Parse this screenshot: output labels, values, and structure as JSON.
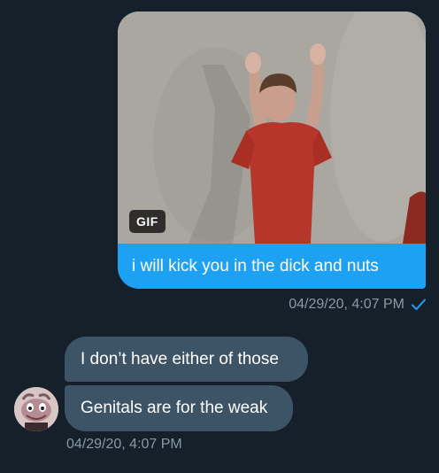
{
  "sent_message": {
    "media_badge": "GIF",
    "text": "i will kick you in the dick and nuts",
    "timestamp": "04/29/20, 4:07 PM",
    "status_icon": "check-icon"
  },
  "received_messages": [
    {
      "text": "I don’t have either of those"
    },
    {
      "text": "Genitals are for the weak"
    }
  ],
  "received_timestamp": "04/29/20, 4:07 PM",
  "colors": {
    "background": "#15202b",
    "sent_bubble": "#1da1f2",
    "received_bubble": "#3d5466",
    "meta_text": "#8899a6"
  }
}
